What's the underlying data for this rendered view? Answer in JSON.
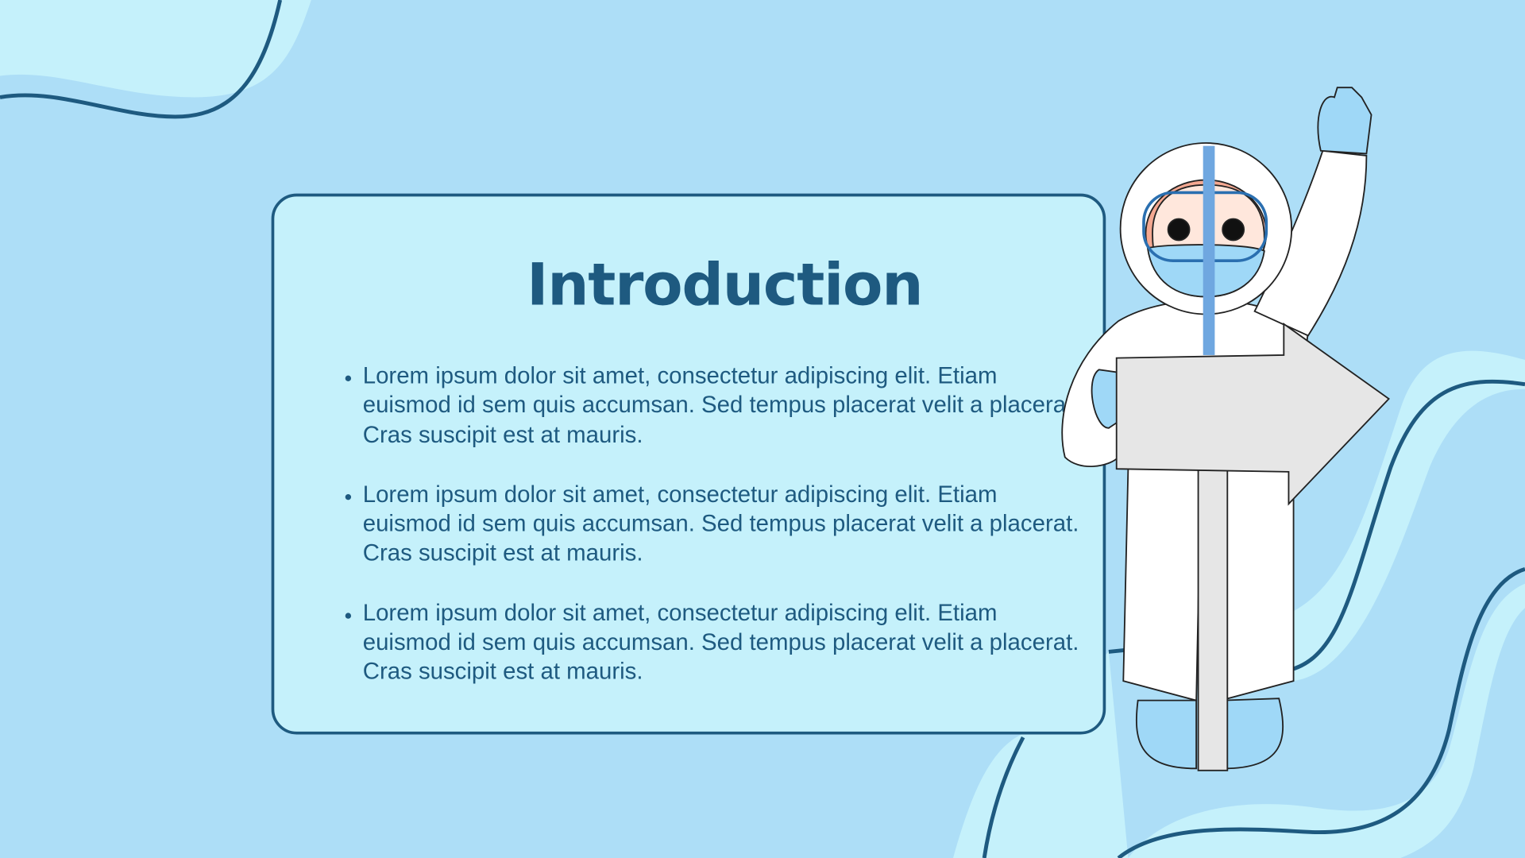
{
  "slide": {
    "title": "Introduction",
    "bullets": [
      "Lorem ipsum dolor sit amet, consectetur adipiscing elit. Etiam euismod id sem quis accumsan. Sed tempus placerat velit a placerat. Cras suscipit est at mauris.",
      "Lorem ipsum dolor sit amet, consectetur adipiscing elit. Etiam euismod id sem quis accumsan. Sed tempus placerat velit a placerat. Cras suscipit est at mauris.",
      "Lorem ipsum dolor sit amet, consectetur adipiscing elit. Etiam euismod id sem quis accumsan. Sed tempus placerat velit a placerat. Cras suscipit est at mauris."
    ]
  },
  "colors": {
    "background": "#addef7",
    "card": "#c5f1fb",
    "accent": "#1e5a80"
  }
}
